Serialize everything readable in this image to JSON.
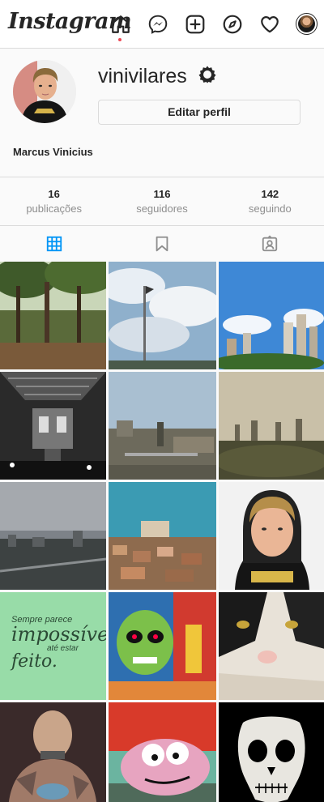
{
  "app": {
    "logo": "Instagram"
  },
  "nav": {
    "icons": [
      "home-icon",
      "messenger-icon",
      "new-post-icon",
      "explore-icon",
      "activity-heart-icon",
      "profile-avatar"
    ]
  },
  "profile": {
    "username": "vinivilares",
    "edit_button": "Editar perfil",
    "full_name": "Marcus Vinicius"
  },
  "stats": [
    {
      "count": "16",
      "label": "publicações"
    },
    {
      "count": "116",
      "label": "seguidores"
    },
    {
      "count": "142",
      "label": "seguindo"
    }
  ],
  "tabs": [
    "posts-grid-icon",
    "saved-bookmark-icon",
    "tagged-icon"
  ],
  "accent_color": "#0095f6",
  "active_tab_color": "#0095f6",
  "posts": [
    {
      "desc": "forest trees"
    },
    {
      "desc": "flag pole clouds"
    },
    {
      "desc": "city skyline blue sky"
    },
    {
      "desc": "station structure black and white"
    },
    {
      "desc": "industrial yard"
    },
    {
      "desc": "city park vintage"
    },
    {
      "desc": "overcast city"
    },
    {
      "desc": "favela city"
    },
    {
      "desc": "selfie hoodie"
    },
    {
      "desc": "quote",
      "lines": [
        "Sempre parece",
        "impossível",
        "até estar",
        "feito."
      ]
    },
    {
      "desc": "graffiti skull"
    },
    {
      "desc": "cat closeup"
    },
    {
      "desc": "tattooed man"
    },
    {
      "desc": "courage cartoon"
    },
    {
      "desc": "ghost skull mask"
    }
  ]
}
